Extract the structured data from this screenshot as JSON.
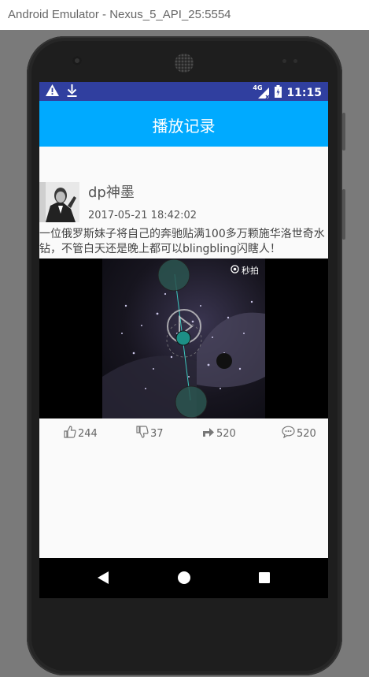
{
  "window": {
    "title": "Android Emulator - Nexus_5_API_25:5554"
  },
  "status_bar": {
    "time": "11:15",
    "network": "4G",
    "icons": [
      "warning-icon",
      "download-icon",
      "signal-icon",
      "battery-icon"
    ]
  },
  "app_bar": {
    "title": "播放记录"
  },
  "post": {
    "username": "dp神墨",
    "timestamp": "2017-05-21 18:42:02",
    "text": "一位俄罗斯妹子将自己的奔驰贴满100多万颗施华洛世奇水钻，不管白天还是晚上都可以blingbling闪瞎人！",
    "video_watermark": "秒拍",
    "likes": "244",
    "dislikes": "37",
    "shares": "520",
    "comments": "520"
  },
  "colors": {
    "status_bar": "#303f9f",
    "app_bar": "#00aaff",
    "screen_bg": "#fafafa",
    "nav_bar": "#000000"
  }
}
